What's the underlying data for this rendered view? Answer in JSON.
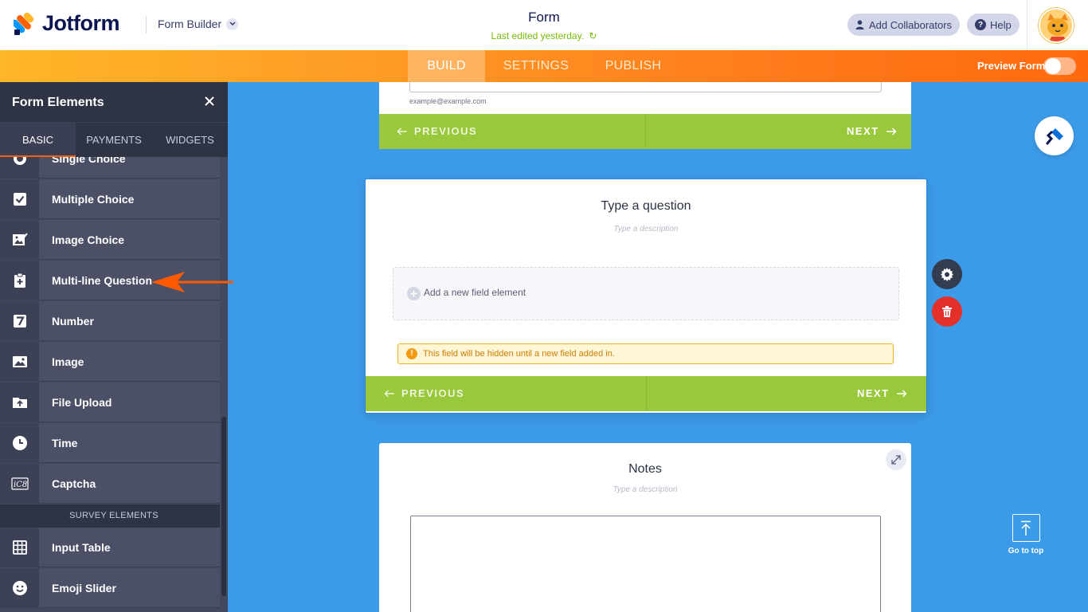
{
  "header": {
    "brand": "Jotform",
    "builder_label": "Form Builder",
    "form_title": "Form",
    "last_edited": "Last edited yesterday.",
    "add_collaborators": "Add Collaborators",
    "help": "Help"
  },
  "nav": {
    "tabs": [
      "BUILD",
      "SETTINGS",
      "PUBLISH"
    ],
    "active_tab": "BUILD",
    "preview_label": "Preview Form",
    "preview_on": false
  },
  "sidebar": {
    "title": "Form Elements",
    "tabs": [
      "BASIC",
      "PAYMENTS",
      "WIDGETS"
    ],
    "active_tab": "BASIC",
    "items": [
      {
        "label": "Single Choice",
        "icon": "radio-icon"
      },
      {
        "label": "Multiple Choice",
        "icon": "checkbox-icon"
      },
      {
        "label": "Image Choice",
        "icon": "image-choice-icon"
      },
      {
        "label": "Multi-line Question",
        "icon": "clipboard-plus-icon"
      },
      {
        "label": "Number",
        "icon": "number-seven-icon"
      },
      {
        "label": "Image",
        "icon": "image-icon"
      },
      {
        "label": "File Upload",
        "icon": "file-upload-icon"
      },
      {
        "label": "Time",
        "icon": "clock-icon"
      },
      {
        "label": "Captcha",
        "icon": "captcha-icon"
      }
    ],
    "section_label": "SURVEY ELEMENTS",
    "survey_items": [
      {
        "label": "Input Table",
        "icon": "table-icon"
      },
      {
        "label": "Emoji Slider",
        "icon": "emoji-icon"
      }
    ]
  },
  "canvas": {
    "email_hint": "example@example.com",
    "prev_label": "PREVIOUS",
    "next_label": "NEXT",
    "multi_card": {
      "question": "Type a question",
      "description": "Type a description",
      "add_field": "Add a new field element",
      "warning": "This field will be hidden until a new field added in."
    },
    "notes_card": {
      "question": "Notes",
      "description": "Type a description"
    },
    "goto_top": "Go to top"
  },
  "colors": {
    "canvas_bg": "#3c9be8",
    "nav_orange": "#ff7b1c",
    "pager_green": "#9ac83c",
    "sidebar_bg": "#43485e",
    "delete_red": "#e3302b",
    "brand_navy": "#0a1551"
  }
}
